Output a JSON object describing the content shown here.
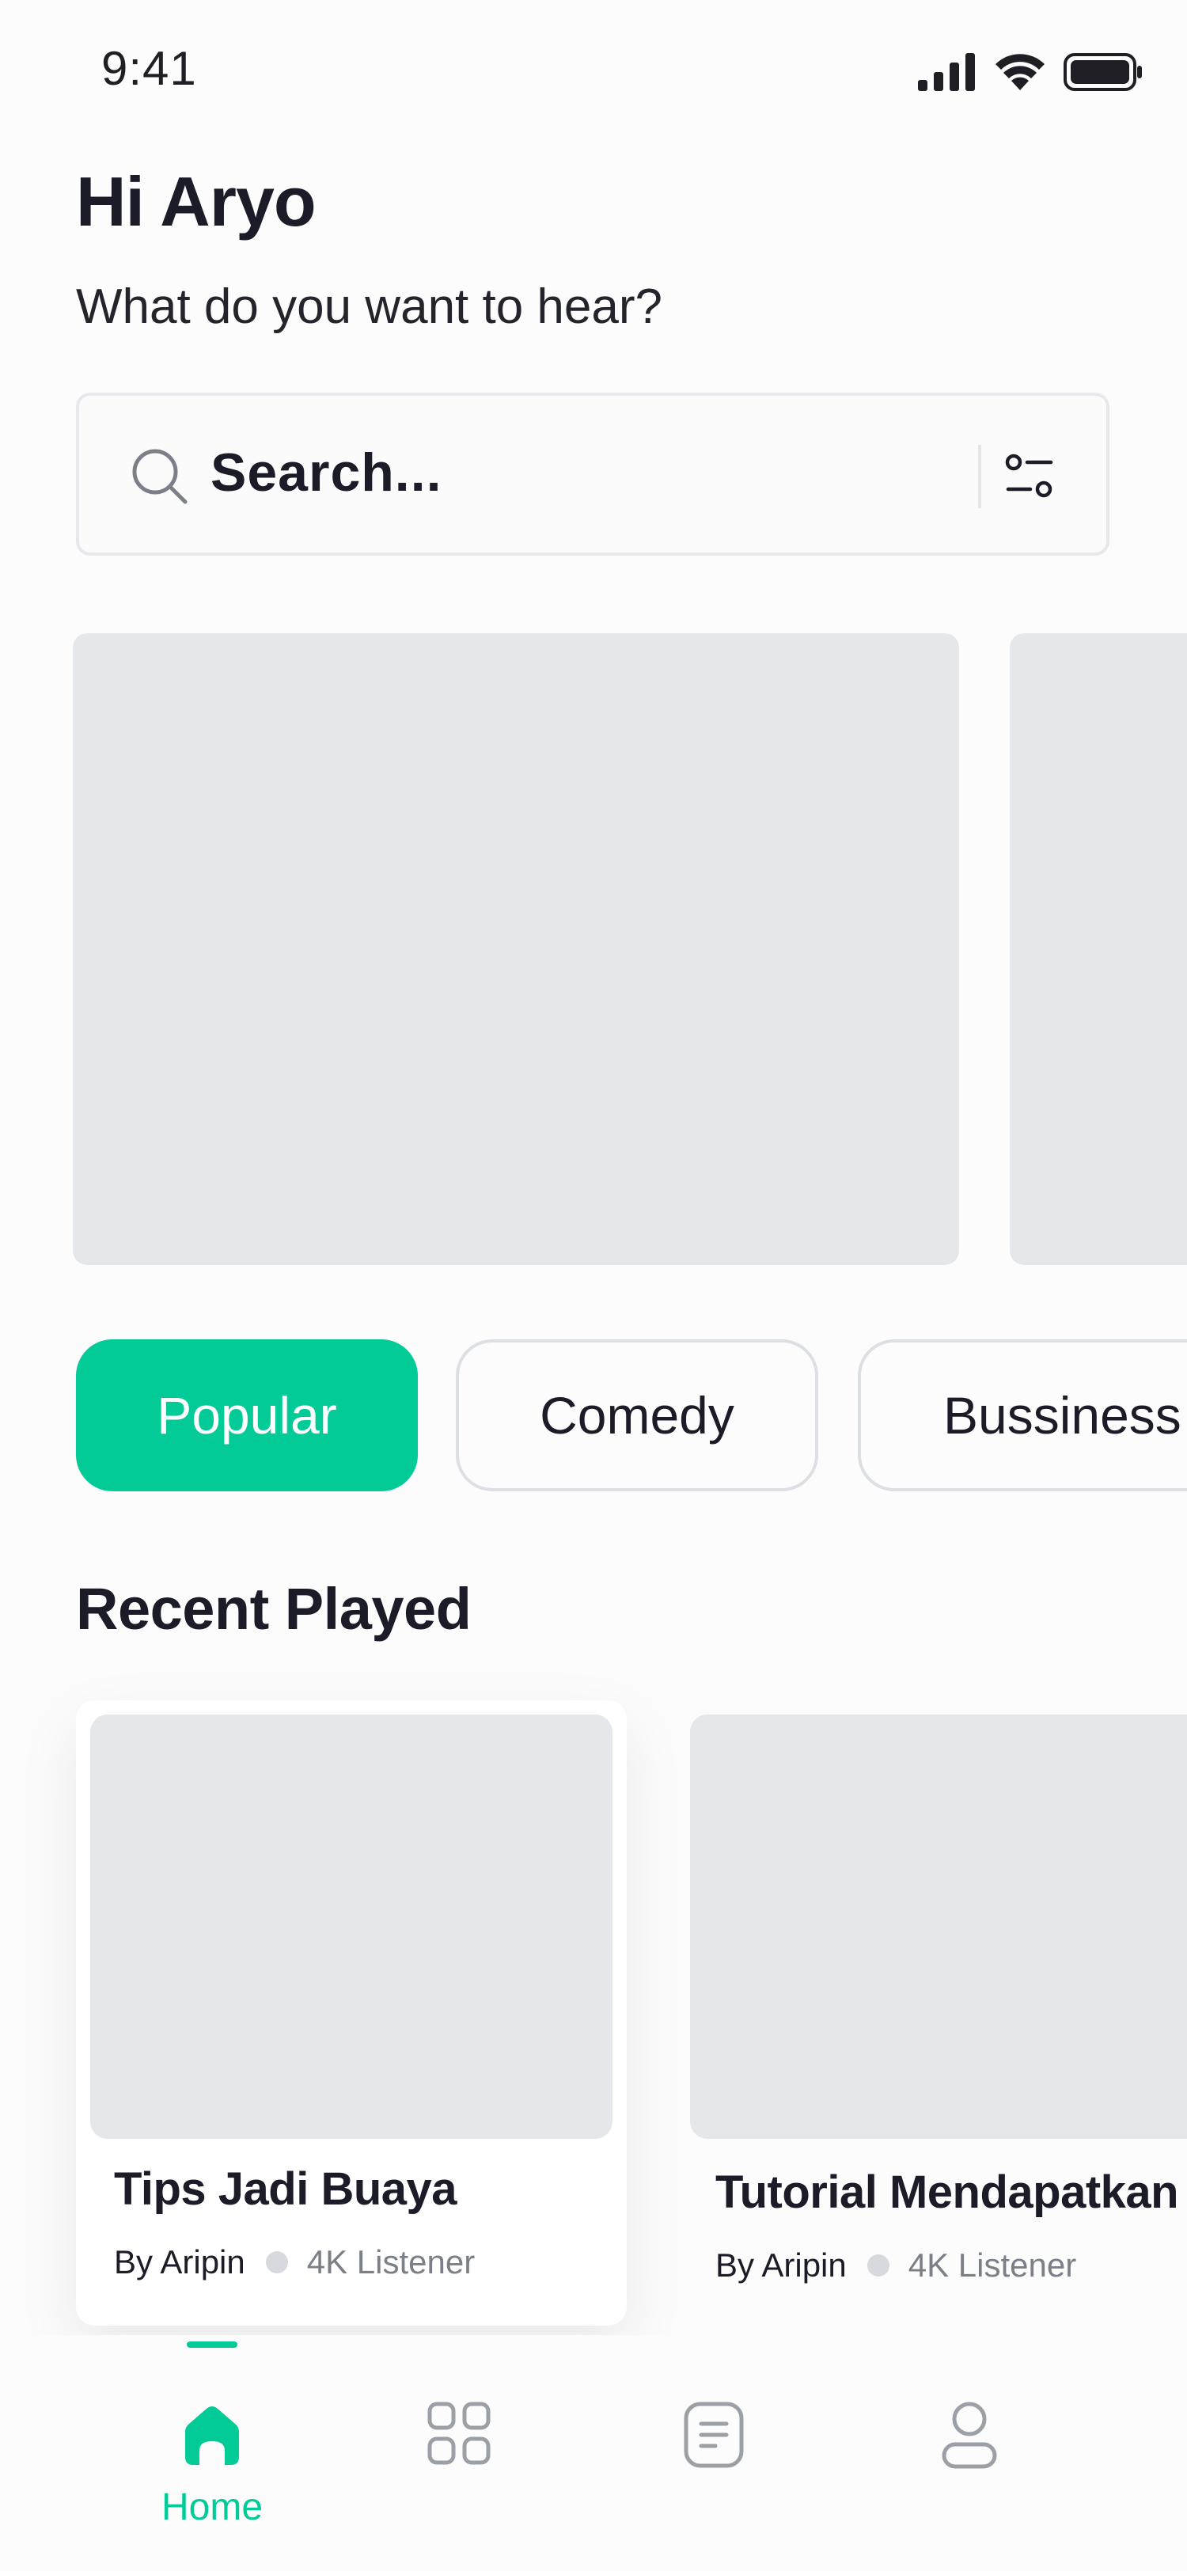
{
  "status_bar": {
    "time": "9:41"
  },
  "header": {
    "greeting": "Hi Aryo",
    "subtitle": "What do you want to hear?"
  },
  "search": {
    "placeholder": "Search..."
  },
  "categories": [
    {
      "label": "Popular",
      "active": true
    },
    {
      "label": "Comedy",
      "active": false
    },
    {
      "label": "Bussiness",
      "active": false
    }
  ],
  "recent": {
    "title": "Recent Played",
    "items": [
      {
        "title": "Tips Jadi Buaya",
        "author": "By Aripin",
        "listeners": "4K Listener"
      },
      {
        "title": "Tutorial Mendapatkan",
        "author": "By Aripin",
        "listeners": "4K Listener"
      }
    ]
  },
  "nav": {
    "items": [
      {
        "label": "Home",
        "icon": "home-icon",
        "active": true
      },
      {
        "label": "",
        "icon": "grid-icon",
        "active": false
      },
      {
        "label": "",
        "icon": "list-icon",
        "active": false
      },
      {
        "label": "",
        "icon": "user-icon",
        "active": false
      }
    ]
  },
  "colors": {
    "accent": "#03CB98",
    "placeholder": "#E4E8EB",
    "text": "#1C1C28",
    "muted": "#7B8088"
  }
}
